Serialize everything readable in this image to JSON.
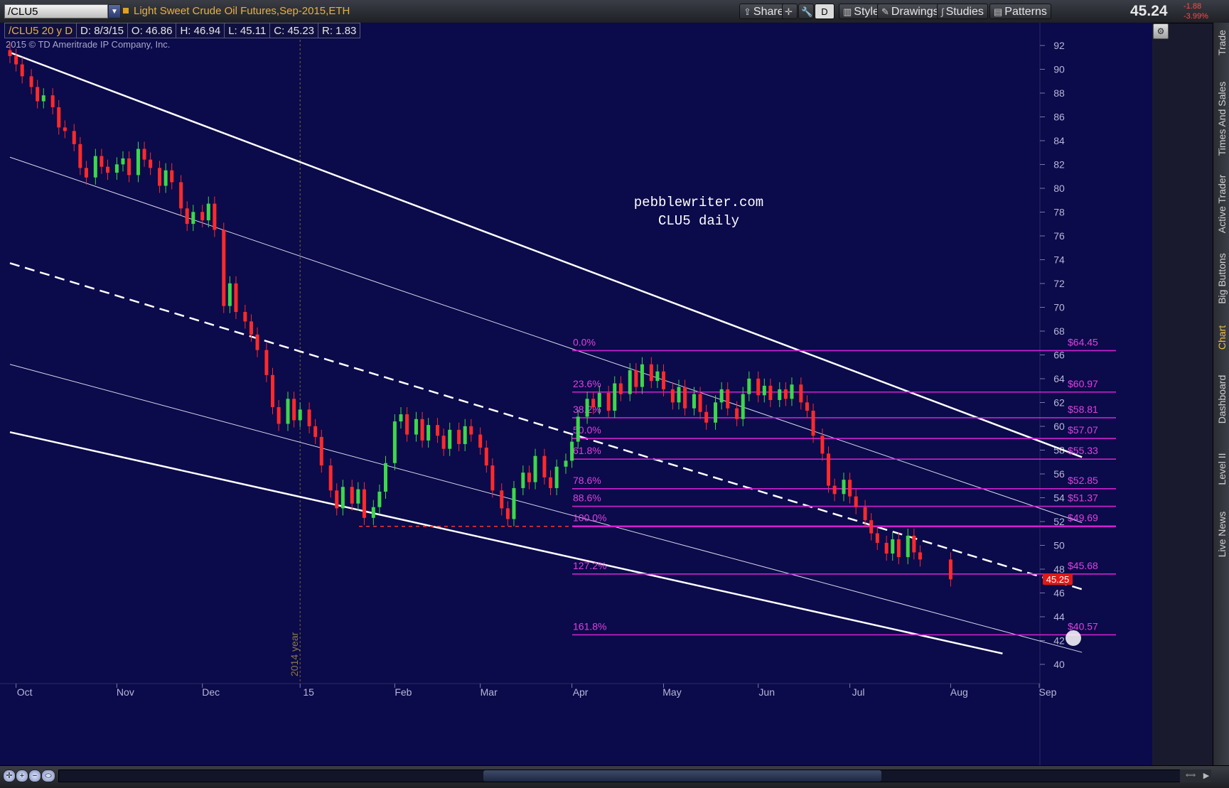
{
  "header": {
    "symbol": "/CLU5",
    "description": "Light Sweet Crude Oil Futures,Sep-2015,ETH",
    "buttons": {
      "share": "Share",
      "style": "Style",
      "drawings": "Drawings",
      "studies": "Studies",
      "patterns": "Patterns",
      "period": "D"
    },
    "last_price": "45.24",
    "change": "-1.88",
    "change_pct": "-3.99%"
  },
  "ohlc": {
    "label": "/CLU5 20 y D",
    "date": "D: 8/3/15",
    "open": "O: 46.86",
    "high": "H: 46.94",
    "low": "L: 45.11",
    "close": "C: 45.23",
    "range": "R: 1.83"
  },
  "sidebar": {
    "tabs": [
      "Trade",
      "Times And Sales",
      "Active Trader",
      "Big Buttons",
      "Chart",
      "Dashboard",
      "Level II",
      "Live News"
    ],
    "active": "Chart"
  },
  "chart_data": {
    "type": "candlestick",
    "copyright": "2015 © TD Ameritrade IP Company, Inc.",
    "watermark": [
      "pebblewriter.com",
      "CLU5 daily"
    ],
    "x_tick_labels": [
      "Oct",
      "Nov",
      "Dec",
      "15",
      "Feb",
      "Mar",
      "Apr",
      "May",
      "Jun",
      "Jul",
      "Aug",
      "Sep"
    ],
    "year_marker": "2014 year",
    "y_ticks": [
      40,
      42,
      44,
      46,
      48,
      50,
      52,
      54,
      56,
      58,
      60,
      62,
      64,
      66,
      68,
      70,
      72,
      74,
      76,
      78,
      80,
      82,
      84,
      86,
      88,
      90,
      92
    ],
    "ylim": [
      39,
      93
    ],
    "current_price": "45.25",
    "fibonacci": [
      {
        "pct": "0.0%",
        "price": "$64.45",
        "value": 64.45
      },
      {
        "pct": "23.6%",
        "price": "$60.97",
        "value": 60.97
      },
      {
        "pct": "38.2%",
        "price": "$58.81",
        "value": 58.81
      },
      {
        "pct": "50.0%",
        "price": "$57.07",
        "value": 57.07
      },
      {
        "pct": "61.8%",
        "price": "$55.33",
        "value": 55.33
      },
      {
        "pct": "78.6%",
        "price": "$52.85",
        "value": 52.85
      },
      {
        "pct": "88.6%",
        "price": "$51.37",
        "value": 51.37
      },
      {
        "pct": "100.0%",
        "price": "$49.69",
        "value": 49.69
      },
      {
        "pct": "127.2%",
        "price": "$45.68",
        "value": 45.68
      },
      {
        "pct": "161.8%",
        "price": "$40.57",
        "value": 40.57
      }
    ],
    "support_level": 49.69,
    "channel_lines": [
      {
        "name": "upper-channel",
        "start": [
          "2014-09-29",
          89.5
        ],
        "end": [
          "2015-09-15",
          55.5
        ],
        "width": "bold"
      },
      {
        "name": "upper-inner-channel",
        "start": [
          "2014-09-29",
          80.7
        ],
        "end": [
          "2015-09-15",
          50.0
        ],
        "width": "thin"
      },
      {
        "name": "midline",
        "start": [
          "2014-09-29",
          71.8
        ],
        "end": [
          "2015-09-15",
          44.4
        ],
        "width": "dashed"
      },
      {
        "name": "lower-inner-channel",
        "start": [
          "2014-09-29",
          63.3
        ],
        "end": [
          "2015-09-15",
          39.1
        ],
        "width": "thin"
      },
      {
        "name": "lower-channel",
        "start": [
          "2014-09-29",
          57.6
        ],
        "end": [
          "2015-08-20",
          39.0
        ],
        "width": "bold"
      }
    ],
    "candles_close": [
      [
        "2014-09-29",
        89.2
      ],
      [
        "2014-10-01",
        88.5
      ],
      [
        "2014-10-03",
        87.5
      ],
      [
        "2014-10-06",
        86.6
      ],
      [
        "2014-10-08",
        85.4
      ],
      [
        "2014-10-10",
        85.9
      ],
      [
        "2014-10-13",
        84.9
      ],
      [
        "2014-10-15",
        83.2
      ],
      [
        "2014-10-17",
        82.9
      ],
      [
        "2014-10-20",
        81.8
      ],
      [
        "2014-10-22",
        79.8
      ],
      [
        "2014-10-24",
        79.0
      ],
      [
        "2014-10-27",
        80.8
      ],
      [
        "2014-10-29",
        79.9
      ],
      [
        "2014-10-31",
        79.4
      ],
      [
        "2014-11-03",
        80.1
      ],
      [
        "2014-11-05",
        80.6
      ],
      [
        "2014-11-07",
        79.2
      ],
      [
        "2014-11-10",
        81.4
      ],
      [
        "2014-11-12",
        80.5
      ],
      [
        "2014-11-14",
        79.8
      ],
      [
        "2014-11-17",
        78.3
      ],
      [
        "2014-11-19",
        79.6
      ],
      [
        "2014-11-21",
        78.6
      ],
      [
        "2014-11-24",
        76.4
      ],
      [
        "2014-11-26",
        75.1
      ],
      [
        "2014-11-28",
        76.1
      ],
      [
        "2014-12-01",
        75.4
      ],
      [
        "2014-12-03",
        76.8
      ],
      [
        "2014-12-05",
        74.6
      ],
      [
        "2014-12-08",
        68.2
      ],
      [
        "2014-12-10",
        70.1
      ],
      [
        "2014-12-12",
        67.7
      ],
      [
        "2014-12-15",
        66.9
      ],
      [
        "2014-12-17",
        65.8
      ],
      [
        "2014-12-19",
        64.5
      ],
      [
        "2014-12-22",
        62.4
      ],
      [
        "2014-12-24",
        59.7
      ],
      [
        "2014-12-26",
        58.3
      ],
      [
        "2014-12-29",
        60.4
      ],
      [
        "2014-12-31",
        58.6
      ],
      [
        "2015-01-02",
        59.5
      ],
      [
        "2015-01-05",
        58.1
      ],
      [
        "2015-01-07",
        57.2
      ],
      [
        "2015-01-09",
        54.8
      ],
      [
        "2015-01-12",
        52.7
      ],
      [
        "2015-01-14",
        51.2
      ],
      [
        "2015-01-16",
        53.0
      ],
      [
        "2015-01-19",
        51.6
      ],
      [
        "2015-01-21",
        52.8
      ],
      [
        "2015-01-23",
        50.4
      ],
      [
        "2015-01-26",
        51.3
      ],
      [
        "2015-01-28",
        52.6
      ],
      [
        "2015-01-30",
        55.0
      ],
      [
        "2015-02-02",
        58.5
      ],
      [
        "2015-02-04",
        59.1
      ],
      [
        "2015-02-06",
        57.4
      ],
      [
        "2015-02-09",
        58.7
      ],
      [
        "2015-02-11",
        56.9
      ],
      [
        "2015-02-13",
        58.2
      ],
      [
        "2015-02-16",
        57.3
      ],
      [
        "2015-02-18",
        56.2
      ],
      [
        "2015-02-20",
        57.8
      ],
      [
        "2015-02-23",
        56.6
      ],
      [
        "2015-02-25",
        58.1
      ],
      [
        "2015-02-27",
        57.4
      ],
      [
        "2015-03-02",
        56.3
      ],
      [
        "2015-03-04",
        54.8
      ],
      [
        "2015-03-06",
        52.7
      ],
      [
        "2015-03-09",
        51.2
      ],
      [
        "2015-03-11",
        50.3
      ],
      [
        "2015-03-13",
        52.9
      ],
      [
        "2015-03-16",
        54.2
      ],
      [
        "2015-03-18",
        53.4
      ],
      [
        "2015-03-20",
        55.6
      ],
      [
        "2015-03-23",
        53.8
      ],
      [
        "2015-03-25",
        52.9
      ],
      [
        "2015-03-27",
        54.7
      ],
      [
        "2015-03-30",
        55.2
      ],
      [
        "2015-04-01",
        56.8
      ],
      [
        "2015-04-03",
        58.9
      ],
      [
        "2015-04-06",
        60.4
      ],
      [
        "2015-04-08",
        59.7
      ],
      [
        "2015-04-10",
        60.9
      ],
      [
        "2015-04-13",
        59.4
      ],
      [
        "2015-04-15",
        61.7
      ],
      [
        "2015-04-17",
        60.8
      ],
      [
        "2015-04-20",
        62.8
      ],
      [
        "2015-04-22",
        61.4
      ],
      [
        "2015-04-24",
        63.3
      ],
      [
        "2015-04-27",
        61.9
      ],
      [
        "2015-04-29",
        62.7
      ],
      [
        "2015-05-01",
        61.2
      ],
      [
        "2015-05-04",
        60.1
      ],
      [
        "2015-05-06",
        61.4
      ],
      [
        "2015-05-08",
        59.6
      ],
      [
        "2015-05-11",
        60.8
      ],
      [
        "2015-05-13",
        59.3
      ],
      [
        "2015-05-15",
        58.4
      ],
      [
        "2015-05-18",
        60.1
      ],
      [
        "2015-05-20",
        61.2
      ],
      [
        "2015-05-22",
        59.6
      ],
      [
        "2015-05-25",
        58.7
      ],
      [
        "2015-05-27",
        60.8
      ],
      [
        "2015-05-29",
        62.1
      ],
      [
        "2015-06-01",
        60.7
      ],
      [
        "2015-06-03",
        61.5
      ],
      [
        "2015-06-05",
        60.3
      ],
      [
        "2015-06-08",
        61.2
      ],
      [
        "2015-06-10",
        60.4
      ],
      [
        "2015-06-12",
        61.6
      ],
      [
        "2015-06-15",
        60.1
      ],
      [
        "2015-06-17",
        59.4
      ],
      [
        "2015-06-19",
        57.3
      ],
      [
        "2015-06-22",
        55.8
      ],
      [
        "2015-06-24",
        53.1
      ],
      [
        "2015-06-26",
        52.4
      ],
      [
        "2015-06-29",
        53.6
      ],
      [
        "2015-07-01",
        52.2
      ],
      [
        "2015-07-03",
        51.3
      ],
      [
        "2015-07-06",
        50.2
      ],
      [
        "2015-07-08",
        49.1
      ],
      [
        "2015-07-10",
        48.3
      ],
      [
        "2015-07-13",
        47.4
      ],
      [
        "2015-07-15",
        48.6
      ],
      [
        "2015-07-17",
        47.1
      ],
      [
        "2015-07-20",
        48.9
      ],
      [
        "2015-07-22",
        47.5
      ],
      [
        "2015-07-24",
        46.9
      ],
      [
        "2015-08-03",
        45.23
      ]
    ]
  }
}
